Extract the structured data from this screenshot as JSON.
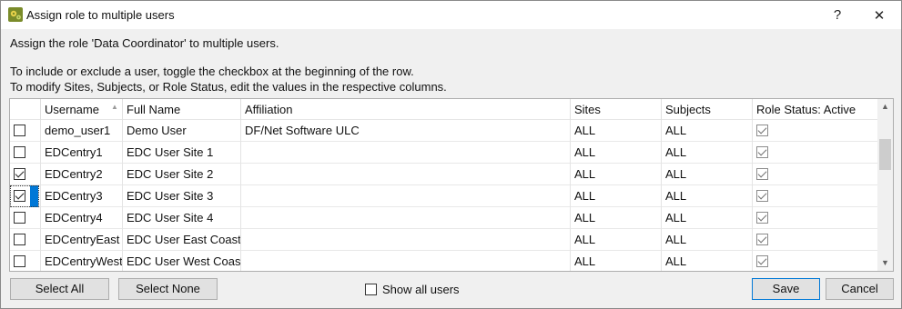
{
  "window": {
    "title": "Assign role to multiple users",
    "help_label": "?",
    "close_label": "✕"
  },
  "instructions": {
    "line1": "Assign the role 'Data Coordinator' to multiple users.",
    "line2": "To include or exclude a user, toggle the checkbox at the beginning of the row.",
    "line3": "To modify Sites, Subjects, or Role Status, edit the values in the respective columns."
  },
  "table": {
    "columns": [
      "",
      "Username",
      "Full Name",
      "Affiliation",
      "Sites",
      "Subjects",
      "Role Status: Active"
    ],
    "rows": [
      {
        "checked": false,
        "username": "demo_user1",
        "full_name": "Demo User",
        "affiliation": "DF/Net Software ULC",
        "sites": "ALL",
        "subjects": "ALL",
        "active": true
      },
      {
        "checked": false,
        "username": "EDCentry1",
        "full_name": "EDC User Site 1",
        "affiliation": "",
        "sites": "ALL",
        "subjects": "ALL",
        "active": true
      },
      {
        "checked": true,
        "username": "EDCentry2",
        "full_name": "EDC User Site 2",
        "affiliation": "",
        "sites": "ALL",
        "subjects": "ALL",
        "active": true
      },
      {
        "checked": true,
        "username": "EDCentry3",
        "full_name": "EDC User Site 3",
        "affiliation": "",
        "sites": "ALL",
        "subjects": "ALL",
        "active": true,
        "focused": true
      },
      {
        "checked": false,
        "username": "EDCentry4",
        "full_name": "EDC User Site 4",
        "affiliation": "",
        "sites": "ALL",
        "subjects": "ALL",
        "active": true
      },
      {
        "checked": false,
        "username": "EDCentryEast",
        "full_name": "EDC User East Coast",
        "affiliation": "",
        "sites": "ALL",
        "subjects": "ALL",
        "active": true
      },
      {
        "checked": false,
        "username": "EDCentryWest",
        "full_name": "EDC User West Coast",
        "affiliation": "",
        "sites": "ALL",
        "subjects": "ALL",
        "active": true
      }
    ]
  },
  "footer": {
    "select_all": "Select All",
    "select_none": "Select None",
    "show_all_users": "Show all users",
    "show_all_checked": false,
    "save": "Save",
    "cancel": "Cancel"
  },
  "colors": {
    "accent": "#0078d7",
    "button_bg": "#e1e1e1",
    "dialog_bg": "#f0f0f0"
  },
  "icons": {
    "app": "app-gear-icon",
    "sort": "sort-up-icon",
    "scroll_up": "chevron-up-icon",
    "scroll_down": "chevron-down-icon"
  }
}
